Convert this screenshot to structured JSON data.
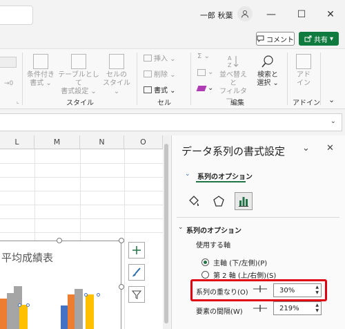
{
  "titlebar": {
    "user_name": "一郎 秋葉",
    "minimize_glyph": "—",
    "maximize_glyph": "☐",
    "close_glyph": "✕"
  },
  "actions": {
    "comment_label": "コメント",
    "share_label": "共有",
    "share_chevron": "▾"
  },
  "ribbon": {
    "styles_group": {
      "label": "スタイル",
      "buttons": [
        {
          "line1": "条件付き",
          "line2": "書式 ⌄",
          "icon": "conditional-format-icon"
        },
        {
          "line1": "テーブルとして",
          "line2": "書式設定 ⌄",
          "icon": "format-as-table-icon"
        },
        {
          "line1": "セルの",
          "line2": "スタイル ⌄",
          "icon": "cell-styles-icon"
        }
      ]
    },
    "cells_group": {
      "label": "セル",
      "insert_label": "挿入 ⌄",
      "delete_label": "削除 ⌄",
      "format_label": "書式 ⌄"
    },
    "editing_group": {
      "label": "編集",
      "autosum_label": "Σ ⌄",
      "sort_filter_line1": "並べ替えと",
      "sort_filter_line2": "フィルター ⌄",
      "find_select_line1": "検索と",
      "find_select_line2": "選択 ⌄"
    },
    "addins_group": {
      "label": "アドイン",
      "addins_line1": "アド",
      "addins_line2": "イン"
    },
    "number_hint": "→0",
    "collapse_glyph": "⌄"
  },
  "sheet": {
    "columns": [
      "L",
      "M",
      "N",
      "O"
    ]
  },
  "chart": {
    "title": "平均成績表"
  },
  "pane": {
    "title": "データ系列の書式設定",
    "title_chevron": "⌄",
    "close_glyph": "✕",
    "tab_label": "系列のオプション",
    "section_label": "系列のオプション",
    "axis_heading": "使用する軸",
    "primary_axis": "主軸 (下/左側)(P)",
    "secondary_axis": "第 2 軸 (上/右側)(S)",
    "overlap_label": "系列の重なり(O)",
    "overlap_value": "30%",
    "gap_label": "要素の間隔(W)",
    "gap_value": "219%"
  },
  "colors": {
    "accent_green": "#217346",
    "share_green": "#0f7b3f",
    "highlight_red": "#e00012",
    "bar_blue": "#4472c4",
    "bar_orange": "#ed7d31",
    "bar_gray": "#a5a5a5",
    "bar_yellow": "#ffc000"
  }
}
